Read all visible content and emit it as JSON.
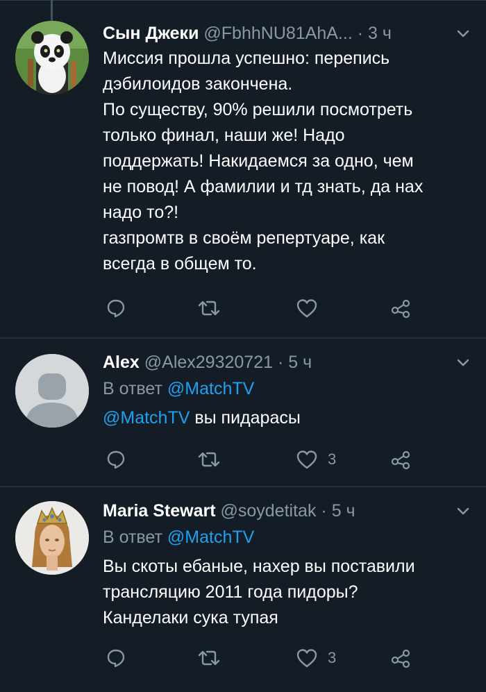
{
  "tweets": [
    {
      "name": "Сын Джеки",
      "handle": "@FbhhNU81AhA...",
      "time": "· 3 ч",
      "reply_label": "",
      "reply_mention": "",
      "text_lines": [
        "Миссия прошла успешно: перепись",
        "дэбилоидов закончена.",
        "По существу, 90% решили посмотреть",
        "только финал, наши же! Надо",
        "поддержать! Накидаемся за одно, чем",
        "не повод! А фамилии и тд знать, да нах",
        "надо то?!",
        "газпромтв в своём репертуаре, как",
        "всегда в общем то."
      ],
      "mention_prefix": "",
      "like_count": ""
    },
    {
      "name": "Alex",
      "handle": "@Alex29320721",
      "time": "· 5 ч",
      "reply_label": "В ответ",
      "reply_mention": "@MatchTV",
      "mention_prefix": "@MatchTV",
      "text_lines": [
        "вы пидарасы"
      ],
      "like_count": "3"
    },
    {
      "name": "Maria Stewart",
      "handle": "@soydetitak",
      "time": "· 5 ч",
      "reply_label": "В ответ",
      "reply_mention": "@MatchTV",
      "mention_prefix": "",
      "text_lines": [
        "Вы скоты ебаные, нахер вы поставили",
        "трансляцию 2011 года пидоры?",
        "Канделаки сука тупая"
      ],
      "like_count": "3"
    }
  ],
  "colors": {
    "background": "#141d26",
    "accent": "#1da1f2",
    "secondary_text": "#8899a6",
    "icon": "#8899a6"
  },
  "icons": [
    "reply-icon",
    "retweet-icon",
    "like-icon",
    "share-icon",
    "chevron-down-icon"
  ]
}
